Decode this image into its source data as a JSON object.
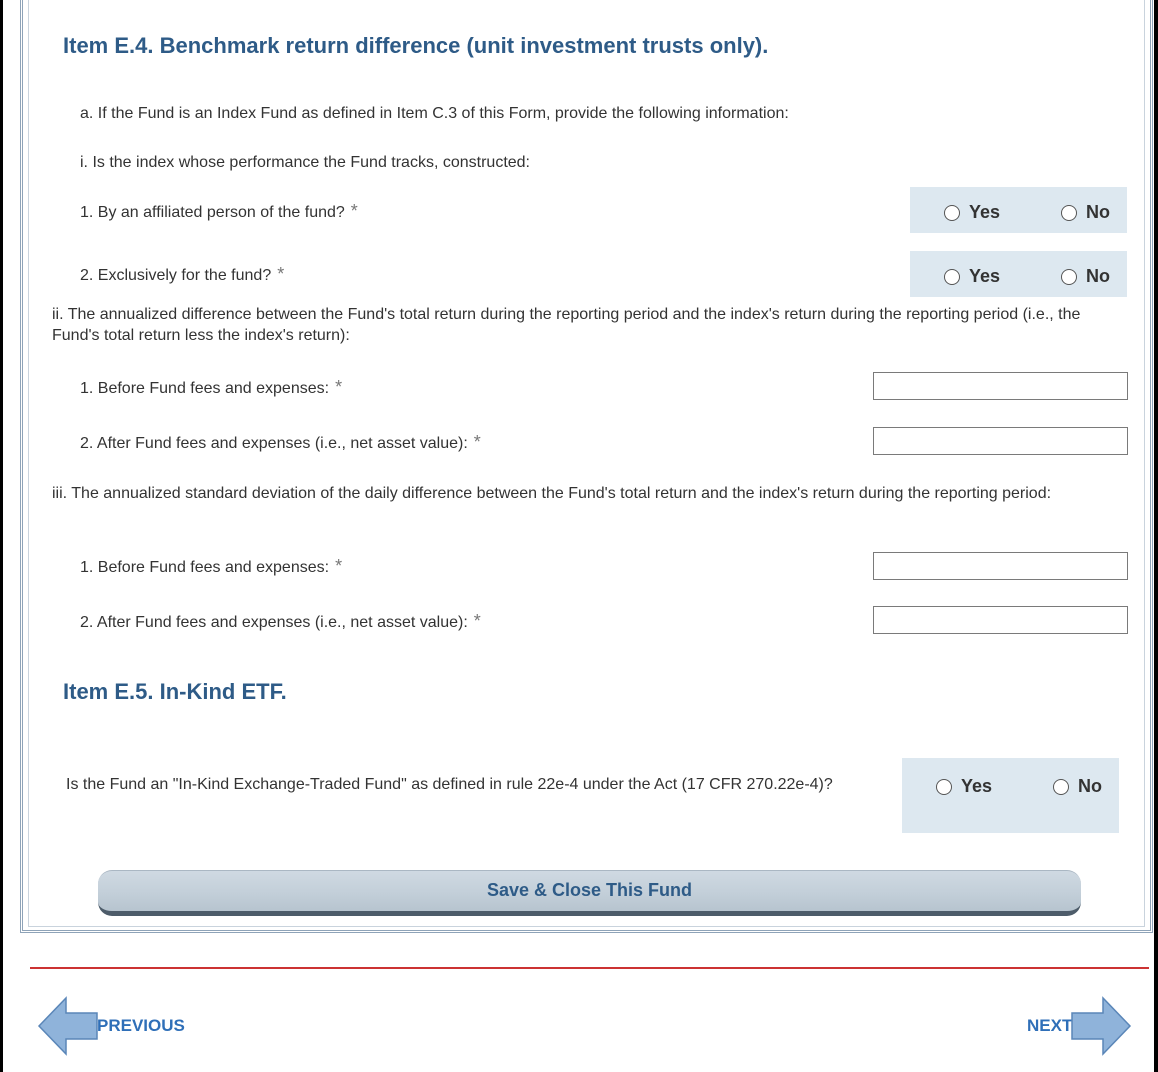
{
  "item_e4": {
    "heading": "Item E.4. Benchmark return difference (unit investment trusts only).",
    "a_text": "a. If the Fund is an Index Fund as defined in Item C.3 of this Form, provide the following information:",
    "i_text": "i. Is the index whose performance the Fund tracks, constructed:",
    "q1_text": "1. By an affiliated person of the fund?",
    "q2_text": "2. Exclusively for the fund?",
    "ii_text": "ii. The annualized difference between the Fund's total return during the reporting period and the index's return during the reporting period (i.e., the Fund's total return less the index's return):",
    "ii_1_text": "1. Before Fund fees and expenses:",
    "ii_2_text": "2. After Fund fees and expenses (i.e., net asset value):",
    "iii_text": "iii. The annualized standard deviation of the daily difference between the Fund's total return and the index's return during the reporting period:",
    "iii_1_text": "1. Before Fund fees and expenses:",
    "iii_2_text": "2. After Fund fees and expenses (i.e., net asset value):",
    "ii_1_value": "",
    "ii_2_value": "",
    "iii_1_value": "",
    "iii_2_value": ""
  },
  "item_e5": {
    "heading": "Item E.5. In-Kind ETF.",
    "question": "Is the Fund an \"In-Kind Exchange-Traded Fund\" as defined in rule 22e-4 under the Act (17 CFR 270.22e-4)?"
  },
  "common": {
    "required_mark": "*",
    "yes_label": "Yes",
    "no_label": "No"
  },
  "buttons": {
    "save_close": "Save & Close This Fund"
  },
  "nav": {
    "previous": "PREVIOUS",
    "next": "NEXT"
  },
  "colors": {
    "heading": "#2e5b87",
    "radio_bg": "#dde8f0",
    "divider": "#cc3333",
    "nav_arrow": "#8fb3da",
    "nav_text": "#2f6fb8"
  }
}
